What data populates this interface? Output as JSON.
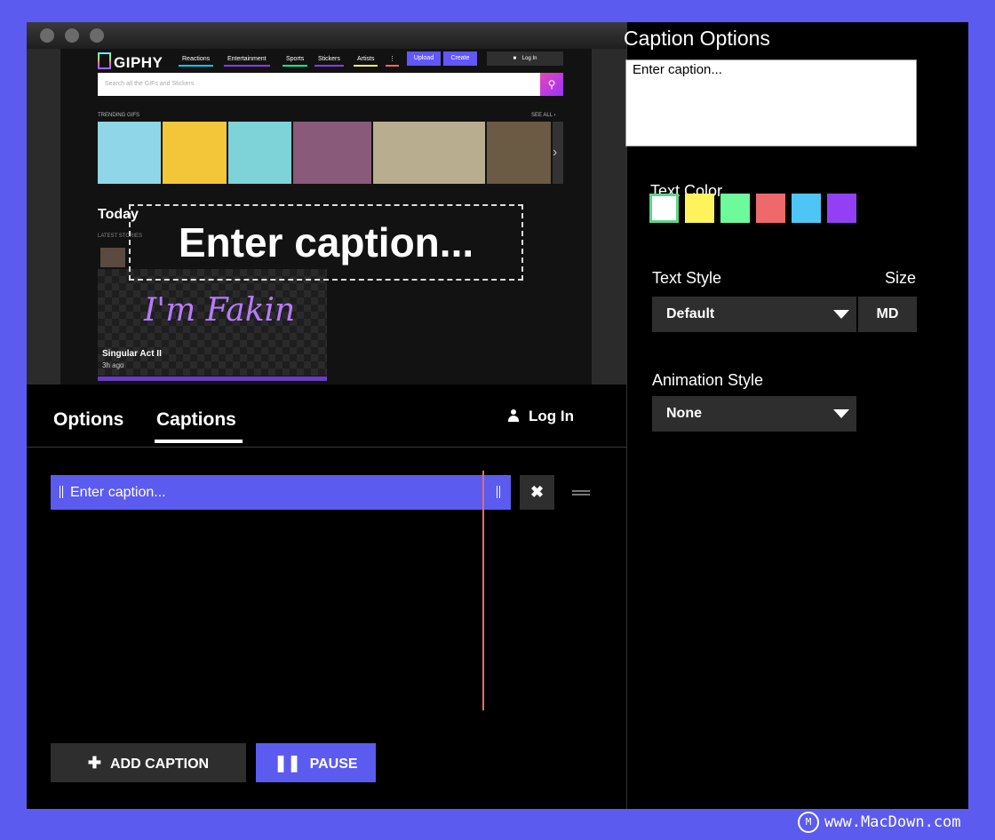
{
  "site": {
    "logo": "GIPHY",
    "nav": [
      "Reactions",
      "Entertainment",
      "Sports",
      "Stickers",
      "Artists"
    ],
    "nav_more": "⋮",
    "upload": "Upload",
    "create": "Create",
    "login": "Log In",
    "search_placeholder": "Search all the GIFs and Stickers",
    "trending": "TRENDING GIFS",
    "see_all": "SEE ALL ›",
    "today": "Today",
    "latest": "LATEST STORIES",
    "story_art": "I'm Fakin",
    "story_title": "Singular Act II",
    "story_time": "3h ago",
    "gif_next": "›"
  },
  "overlay": {
    "caption": "Enter caption..."
  },
  "tabs": {
    "options": "Options",
    "captions": "Captions",
    "login": "Log In"
  },
  "timeline": {
    "caption_text": "Enter caption...",
    "delete_icon": "✖",
    "add_caption": "ADD CAPTION",
    "pause": "PAUSE"
  },
  "panel": {
    "title": "Caption Options",
    "caption_value": "Enter caption...",
    "text_color_label": "Text Color",
    "colors": [
      "#ffffff",
      "#fff35c",
      "#6dfa9a",
      "#ee6a6a",
      "#4ec6f5",
      "#9340f5"
    ],
    "text_style_label": "Text Style",
    "text_style_value": "Default",
    "size_label": "Size",
    "size_value": "MD",
    "animation_label": "Animation Style",
    "animation_value": "None"
  },
  "watermark": "www.MacDown.com"
}
